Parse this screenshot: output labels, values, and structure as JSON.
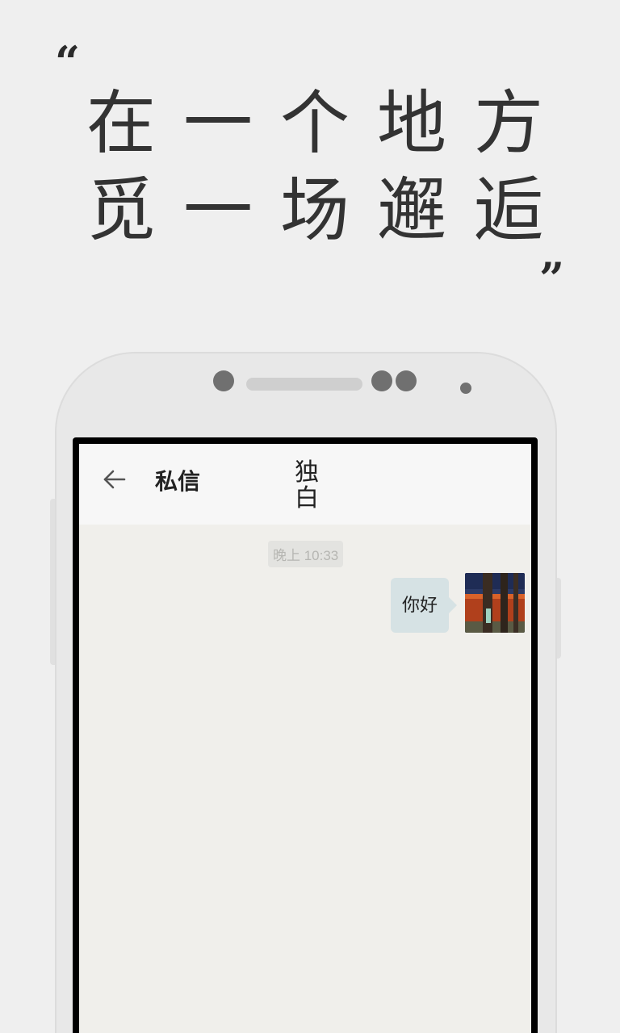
{
  "headline": {
    "open_quote": "“",
    "close_quote": "”",
    "line1": [
      "在",
      "一",
      "个",
      "地",
      "方"
    ],
    "line2": [
      "觅",
      "一",
      "场",
      "邂",
      "逅"
    ]
  },
  "app_bar": {
    "back_icon": "arrow-left-icon",
    "title": "私信",
    "logo": "独\n白"
  },
  "chat": {
    "timestamp": "晚上 10:33",
    "messages": [
      {
        "text": "你好",
        "sender": "self"
      }
    ]
  },
  "colors": {
    "page_bg": "#efefef",
    "phone_body": "#e8e8e8",
    "chat_bg": "#f0efeb",
    "bubble": "#d6e2e4"
  }
}
